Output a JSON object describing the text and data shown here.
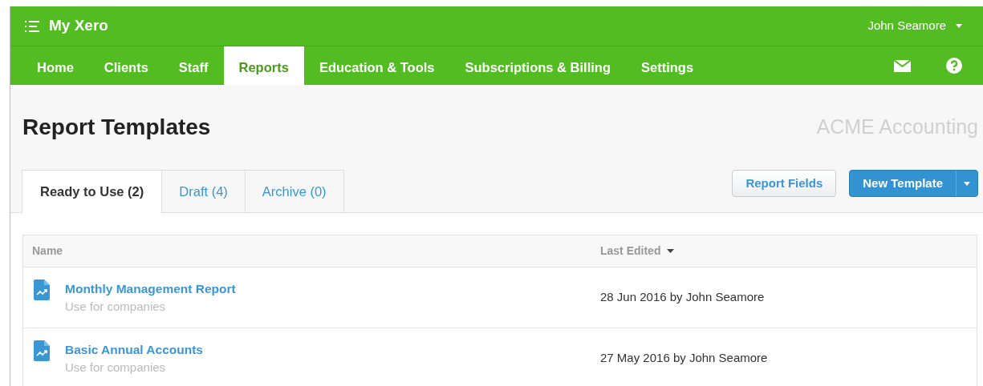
{
  "app": {
    "title": "My Xero",
    "user": "John Seamore"
  },
  "nav": [
    {
      "label": "Home",
      "selected": false
    },
    {
      "label": "Clients",
      "selected": false
    },
    {
      "label": "Staff",
      "selected": false
    },
    {
      "label": "Reports",
      "selected": true
    },
    {
      "label": "Education & Tools",
      "selected": false
    },
    {
      "label": "Subscriptions & Billing",
      "selected": false
    },
    {
      "label": "Settings",
      "selected": false
    }
  ],
  "page": {
    "title": "Report Templates",
    "organisation": "ACME Accounting"
  },
  "tabs": [
    {
      "label": "Ready to Use (2)",
      "selected": true
    },
    {
      "label": "Draft (4)",
      "selected": false
    },
    {
      "label": "Archive (0)",
      "selected": false
    }
  ],
  "buttons": {
    "report_fields": "Report Fields",
    "new_template": "New Template"
  },
  "table": {
    "columns": [
      "Name",
      "Last Edited"
    ],
    "rows": [
      {
        "name": "Monthly Management Report",
        "description": "Use for companies",
        "last_edited": "28 Jun 2016 by John Seamore"
      },
      {
        "name": "Basic Annual Accounts",
        "description": "Use for companies",
        "last_edited": "27 May 2016 by John Seamore"
      }
    ]
  }
}
